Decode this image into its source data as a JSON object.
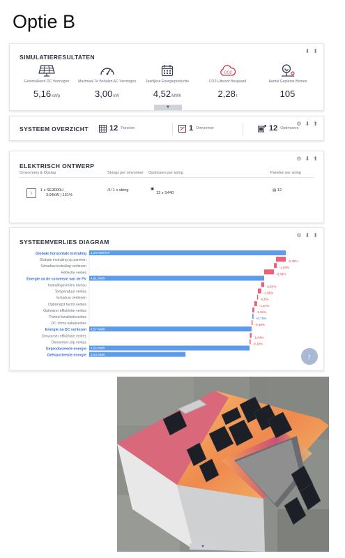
{
  "page": {
    "title": "Optie B"
  },
  "simulation": {
    "title": "SIMULATIERESULTATEN",
    "items": [
      {
        "icon": "solar-panel-icon",
        "label": "Geïnstalleerd DC Vermogen",
        "value": "5,16",
        "unit": "kWp"
      },
      {
        "icon": "speedometer-icon",
        "label": "Maximaal Te Behalen AC Vermogen",
        "value": "3,00",
        "unit": "kW"
      },
      {
        "icon": "calendar-icon",
        "label": "Jaarlijkse Energieproductie",
        "value": "4,52",
        "unit": "MWh"
      },
      {
        "icon": "co2-cloud-icon",
        "label": "CO2-Uitstoot Bespaard",
        "value": "2,28",
        "unit": "t"
      },
      {
        "icon": "tree-icon",
        "label": "Aantal Geplante Bomen",
        "value": "105",
        "unit": ""
      }
    ],
    "collapse_icon": "chevron-down-icon"
  },
  "overview": {
    "title": "SYSTEEM OVERZICHT",
    "panels_count": "12",
    "panels_label": "Panelen",
    "inverter_count": "1",
    "inverter_label": "Omvormer",
    "optimizer_count": "12",
    "optimizer_label": "Optimizers"
  },
  "electrical": {
    "title": "ELEKTRISCH ONTWERP",
    "columns": [
      "Omvormers & Opslag",
      "Strings per omvormer",
      "Optimizers per string",
      "Panelen per string"
    ],
    "row": {
      "inverter": "1 x SE3000H",
      "inverter_sub": "3.94kW | 131%",
      "strings": "1 x string",
      "optimizers": "12 x S440",
      "panels": "12"
    }
  },
  "loss": {
    "title": "SYSTEEMVERLIES DIAGRAM"
  },
  "chart_data": {
    "type": "bar",
    "subtype": "waterfall",
    "title": "SYSTEEMVERLIES DIAGRAM",
    "colors": {
      "total": "#5b9bea",
      "loss": "#ef5f78",
      "gain": "#5b9bea"
    },
    "rows": [
      {
        "label": "Globale horizontale instraling",
        "kind": "total",
        "start": 0,
        "end": 1.0,
        "value_label": "1,04 MWh/m²",
        "bold": true
      },
      {
        "label": "Globale instraling op panelen",
        "kind": "loss",
        "start": 0.95,
        "end": 1.0,
        "value_label": "-2,75%"
      },
      {
        "label": "Schaduw instraling verliezen",
        "kind": "loss",
        "start": 0.94,
        "end": 0.955,
        "value_label": "-1,15%"
      },
      {
        "label": "Reflectie verlies",
        "kind": "loss",
        "start": 0.89,
        "end": 0.94,
        "value_label": "-3,54%"
      },
      {
        "label": "Energie na de conversie van de PV",
        "kind": "total",
        "start": 0,
        "end": 0.89,
        "value_label": "4,91 MWh",
        "bold": true
      },
      {
        "label": "Instralingsverlies niveau",
        "kind": "loss",
        "start": 0.875,
        "end": 0.89,
        "value_label": "-0,54%"
      },
      {
        "label": "Temperatuur verlies",
        "kind": "loss",
        "start": 0.858,
        "end": 0.875,
        "value_label": "-1,95%"
      },
      {
        "label": "Schaduw verliezen",
        "kind": "loss",
        "start": 0.854,
        "end": 0.858,
        "value_label": "-0,5%"
      },
      {
        "label": "Opbrengst factor verlies",
        "kind": "loss",
        "start": 0.84,
        "end": 0.854,
        "value_label": "-1,67%"
      },
      {
        "label": "Optimizer efficiëntie verlies",
        "kind": "loss",
        "start": 0.83,
        "end": 0.84,
        "value_label": "-1,04%"
      },
      {
        "label": "Paneel kwaliteitsverlies",
        "kind": "gain",
        "start": 0.83,
        "end": 0.836,
        "value_label": "+0,75%"
      },
      {
        "label": "DC ohms kabelverlies",
        "kind": "loss",
        "start": 0.826,
        "end": 0.83,
        "value_label": "-0,49%"
      },
      {
        "label": "Energie na DC verliezen",
        "kind": "total",
        "start": 0,
        "end": 0.826,
        "value_label": "4,57 MWh",
        "bold": true
      },
      {
        "label": "Omvormer efficiëntie verlies",
        "kind": "loss",
        "start": 0.817,
        "end": 0.826,
        "value_label": "-1,04%"
      },
      {
        "label": "Omvormer-clip verlies",
        "kind": "loss",
        "start": 0.816,
        "end": 0.818,
        "value_label": "-0,18%"
      },
      {
        "label": "Geproduceerde energie",
        "kind": "total",
        "start": 0,
        "end": 0.816,
        "value_label": "4,52 MWh",
        "bold": true
      },
      {
        "label": "Geëxporteerde energie",
        "kind": "total",
        "start": 0,
        "end": 0.49,
        "value_label": "3,54 MWh",
        "bold": true
      }
    ]
  },
  "tools": {
    "gear": "gear-icon",
    "down": "arrow-down-icon",
    "up": "arrow-up-icon"
  },
  "scroll": {
    "icon": "arrow-up-icon"
  }
}
